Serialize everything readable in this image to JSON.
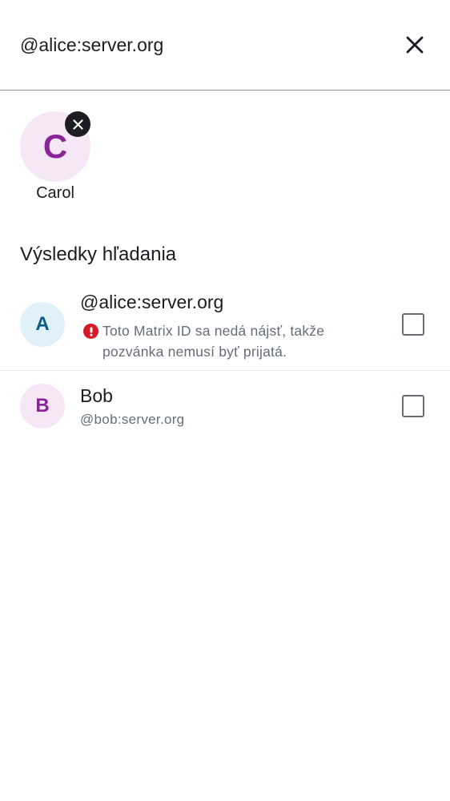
{
  "search": {
    "value": "@alice:server.org",
    "placeholder": ""
  },
  "selected": [
    {
      "initial": "C",
      "name": "Carol"
    }
  ],
  "section_title": "Výsledky hľadania",
  "results": [
    {
      "initial": "A",
      "title": "@alice:server.org",
      "warning": "Toto Matrix ID sa nedá nájsť, takže pozvánka nemusí byť prijatá.",
      "checked": false
    },
    {
      "initial": "B",
      "title": "Bob",
      "subtitle": "@bob:server.org",
      "checked": false
    }
  ],
  "icons": {
    "close": "close-icon",
    "chip_remove": "close-icon",
    "warning": "error-icon"
  },
  "colors": {
    "text_primary": "#1b1d22",
    "text_secondary": "#656d77",
    "error": "#d51928",
    "avatar_purple_bg": "#f6e7f7",
    "avatar_purple_fg": "#8a2597",
    "avatar_blue_bg": "#e1f1f8",
    "avatar_blue_fg": "#0e5a86"
  }
}
